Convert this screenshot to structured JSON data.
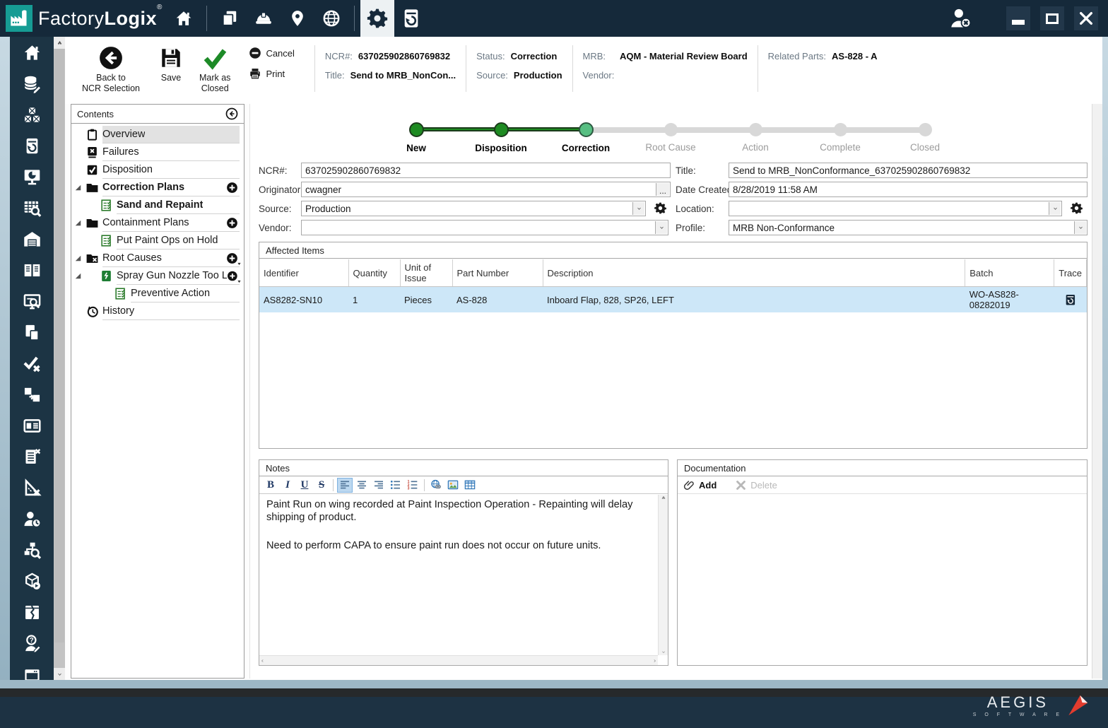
{
  "titlebar": {
    "brand_factory": "Factory",
    "brand_logix": "Logix",
    "brand_reg": "®",
    "nav_groups": [
      [
        "home-icon"
      ],
      [
        "pages-icon",
        "hardhat-icon",
        "map-pin-icon",
        "globe-icon"
      ],
      [
        "gear-icon",
        "device-restore-icon"
      ]
    ],
    "active_nav": "gear-icon",
    "window_icons": [
      "logout-user-icon",
      "minimize-icon",
      "maximize-icon",
      "close-icon"
    ]
  },
  "sidebar": {
    "icons": [
      "home-icon",
      "database-edit-icon",
      "assembly-icon",
      "device-restore-icon",
      "dashboard-icon",
      "table-search-icon",
      "warehouse-icon",
      "library-icon",
      "monitor-search-icon",
      "documents-icon",
      "verify-icon",
      "transfer-icon",
      "id-card-icon",
      "list-remove-icon",
      "measure-remove-icon",
      "user-time-icon",
      "org-search-icon",
      "package-run-icon",
      "label-torn-icon",
      "user-question-icon",
      "terminal-icon"
    ]
  },
  "toolbar": {
    "back": {
      "line1": "Back to",
      "line2": "NCR Selection"
    },
    "save": {
      "line1": "Save",
      "line2": ""
    },
    "mark": {
      "line1": "Mark as",
      "line2": "Closed"
    },
    "cancel": "Cancel",
    "print": "Print"
  },
  "header_info": {
    "ncr_label": "NCR#:",
    "ncr_value": "637025902860769832",
    "title_label": "Title:",
    "title_value": "Send to MRB_NonCon...",
    "status_label": "Status:",
    "status_value": "Correction",
    "source_label": "Source:",
    "source_value": "Production",
    "mrb_label": "MRB:",
    "mrb_value": "AQM - Material Review Board",
    "vendor_label": "Vendor:",
    "vendor_value": "",
    "related_label": "Related Parts:",
    "related_value": "AS-828 - A"
  },
  "contents": {
    "title": "Contents",
    "items": [
      {
        "label": "Overview",
        "icon": "clipboard-icon",
        "level": 0,
        "selected": true
      },
      {
        "label": "Failures",
        "icon": "failure-icon",
        "level": 0
      },
      {
        "label": "Disposition",
        "icon": "disposition-icon",
        "level": 0
      },
      {
        "label": "Correction Plans",
        "icon": "folder-icon",
        "level": 0,
        "bold": true,
        "expander": true,
        "add": true
      },
      {
        "label": "Sand and Repaint",
        "icon": "checklist-icon",
        "level": 1,
        "bold": true
      },
      {
        "label": "Containment Plans",
        "icon": "folder-icon",
        "level": 0,
        "expander": true,
        "add": true
      },
      {
        "label": "Put Paint Ops on Hold",
        "icon": "checklist-icon",
        "level": 1
      },
      {
        "label": "Root Causes",
        "icon": "folder-x-icon",
        "level": 0,
        "expander": true,
        "add": true,
        "add_caret": true
      },
      {
        "label": "Spray Gun Nozzle Too L...",
        "icon": "green-doc-icon",
        "level": 1,
        "expander": true,
        "add": true,
        "add_caret": true
      },
      {
        "label": "Preventive Action",
        "icon": "checklist-icon",
        "level": 2
      },
      {
        "label": "History",
        "icon": "history-icon",
        "level": 0
      }
    ]
  },
  "stepper": {
    "steps": [
      {
        "label": "New",
        "state": "complete"
      },
      {
        "label": "Disposition",
        "state": "complete"
      },
      {
        "label": "Correction",
        "state": "current"
      },
      {
        "label": "Root Cause",
        "state": "future"
      },
      {
        "label": "Action",
        "state": "future"
      },
      {
        "label": "Complete",
        "state": "future"
      },
      {
        "label": "Closed",
        "state": "future"
      }
    ]
  },
  "form": {
    "ncr": {
      "label": "NCR#:",
      "value": "637025902860769832"
    },
    "originator": {
      "label": "Originator:",
      "value": "cwagner",
      "more": "..."
    },
    "source": {
      "label": "Source:",
      "value": "Production"
    },
    "vendor": {
      "label": "Vendor:",
      "value": ""
    },
    "title": {
      "label": "Title:",
      "value": "Send to MRB_NonConformance_637025902860769832"
    },
    "date_created": {
      "label": "Date Created:",
      "value": "8/28/2019 11:58 AM"
    },
    "location": {
      "label": "Location:",
      "value": ""
    },
    "profile": {
      "label": "Profile:",
      "value": "MRB Non-Conformance"
    }
  },
  "affected_items": {
    "title": "Affected Items",
    "columns": [
      "Identifier",
      "Quantity",
      "Unit of Issue",
      "Part Number",
      "Description",
      "Batch",
      "Trace"
    ],
    "rows": [
      {
        "identifier": "AS8282-SN10",
        "quantity": "1",
        "unit": "Pieces",
        "part": "AS-828",
        "description": "Inboard Flap, 828, SP26, LEFT",
        "batch": "WO-AS828-08282019",
        "trace_icon": "trace-icon"
      }
    ]
  },
  "notes": {
    "title": "Notes",
    "toolbar": [
      {
        "name": "bold-button",
        "glyph": "B",
        "kind": "fmt"
      },
      {
        "name": "italic-button",
        "glyph": "I",
        "kind": "fmt i"
      },
      {
        "name": "underline-button",
        "glyph": "U",
        "kind": "fmt u"
      },
      {
        "name": "strikethrough-button",
        "glyph": "S",
        "kind": "fmt s"
      },
      {
        "name": "separator",
        "kind": "sep"
      },
      {
        "name": "align-left-button",
        "icon": "align-left-icon",
        "active": true
      },
      {
        "name": "align-center-button",
        "icon": "align-center-icon"
      },
      {
        "name": "align-right-button",
        "icon": "align-right-icon"
      },
      {
        "name": "bullet-list-button",
        "icon": "bullet-list-icon"
      },
      {
        "name": "numbered-list-button",
        "icon": "number-list-icon"
      },
      {
        "name": "separator",
        "kind": "sep"
      },
      {
        "name": "insert-link-button",
        "icon": "link-icon"
      },
      {
        "name": "insert-image-button",
        "icon": "image-icon"
      },
      {
        "name": "insert-table-button",
        "icon": "table-icon"
      }
    ],
    "paragraphs": [
      "Paint Run on wing recorded at Paint Inspection Operation - Repainting will delay shipping of product.",
      "",
      "Need to perform CAPA to ensure paint run does not occur on future units."
    ]
  },
  "documentation": {
    "title": "Documentation",
    "add_label": "Add",
    "delete_label": "Delete"
  },
  "footer": {
    "brand": "AEGIS",
    "sub": "S O F T W A R E"
  }
}
